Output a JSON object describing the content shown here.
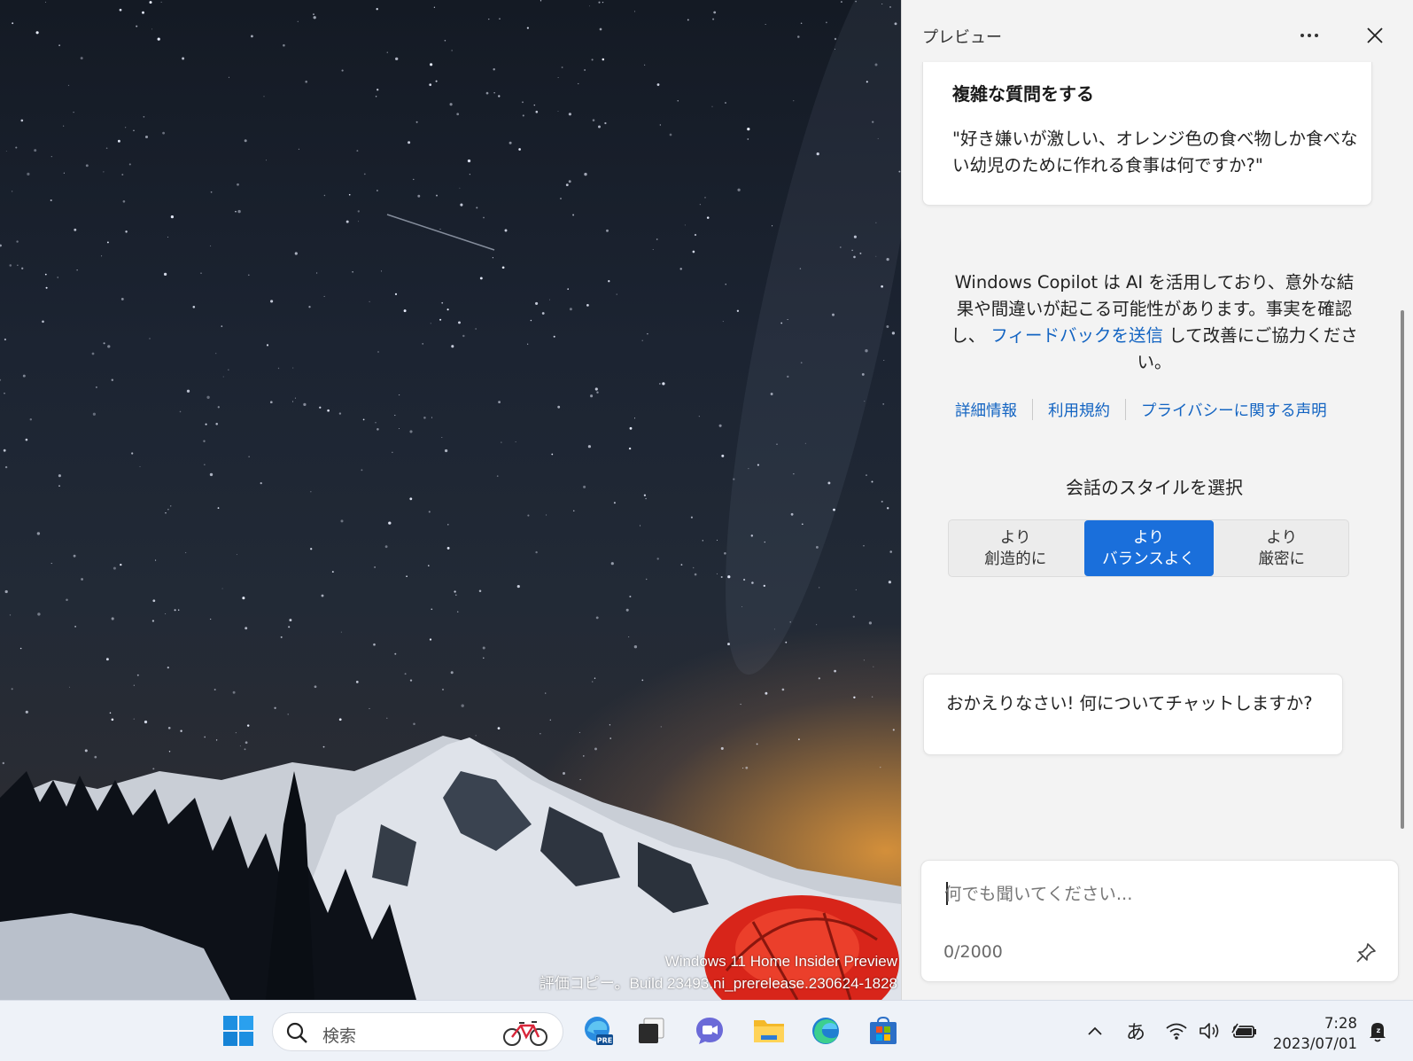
{
  "desktop": {
    "watermark_line1": "Windows 11 Home Insider Preview",
    "watermark_line2": "評価コピー。Build 23493.ni_prerelease.230624-1828"
  },
  "copilot": {
    "title": "プレビュー",
    "suggestion": {
      "heading": "複雑な質問をする",
      "body": "\"好き嫌いが激しい、オレンジ色の食べ物しか食べない幼児のために作れる食事は何ですか?\""
    },
    "disclaimer": {
      "text_before": "Windows Copilot は AI を活用しており、意外な結果や間違いが起こる可能性があります。事実を確認し、",
      "link": "フィードバックを送信",
      "text_after": "して改善にご協力ください。"
    },
    "links": [
      "詳細情報",
      "利用規約",
      "プライバシーに関する声明"
    ],
    "style_title": "会話のスタイルを選択",
    "styles": [
      {
        "line1": "より",
        "line2": "創造的に",
        "active": false
      },
      {
        "line1": "より",
        "line2": "バランスよく",
        "active": true
      },
      {
        "line1": "より",
        "line2": "厳密に",
        "active": false
      }
    ],
    "greeting": "おかえりなさい! 何についてチャットしますか?",
    "input_placeholder": "何でも聞いてください...",
    "char_count": "0/2000",
    "accent_color": "#1a6fdb",
    "link_color": "#1364c2"
  },
  "taskbar": {
    "search_label": "検索",
    "apps": [
      "start-icon",
      "edge-preview-icon",
      "task-view-icon",
      "teams-chat-icon",
      "file-explorer-icon",
      "edge-icon",
      "store-icon"
    ],
    "ime": "あ",
    "time": "7:28",
    "date": "2023/07/01"
  }
}
